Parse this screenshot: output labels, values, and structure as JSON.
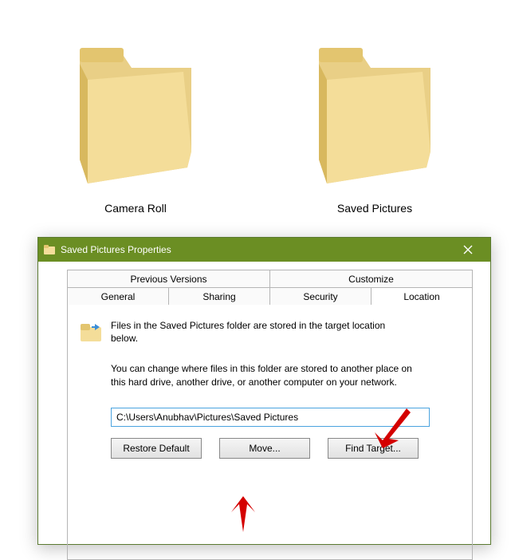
{
  "desktop": {
    "folders": [
      {
        "label": "Camera Roll"
      },
      {
        "label": "Saved Pictures"
      }
    ]
  },
  "dialog": {
    "title": "Saved Pictures Properties",
    "tabs_row1": [
      {
        "label": "Previous Versions",
        "active": false
      },
      {
        "label": "Customize",
        "active": false
      }
    ],
    "tabs_row2": [
      {
        "label": "General",
        "active": false
      },
      {
        "label": "Sharing",
        "active": false
      },
      {
        "label": "Security",
        "active": false
      },
      {
        "label": "Location",
        "active": true
      }
    ],
    "info1": "Files in the Saved Pictures folder are stored in the target location below.",
    "info2": "You can change where files in this folder are stored to another place on this hard drive, another drive, or another computer on your network.",
    "path_value": "C:\\Users\\Anubhav\\Pictures\\Saved Pictures",
    "buttons": {
      "restore": "Restore Default",
      "move": "Move...",
      "find": "Find Target..."
    }
  }
}
